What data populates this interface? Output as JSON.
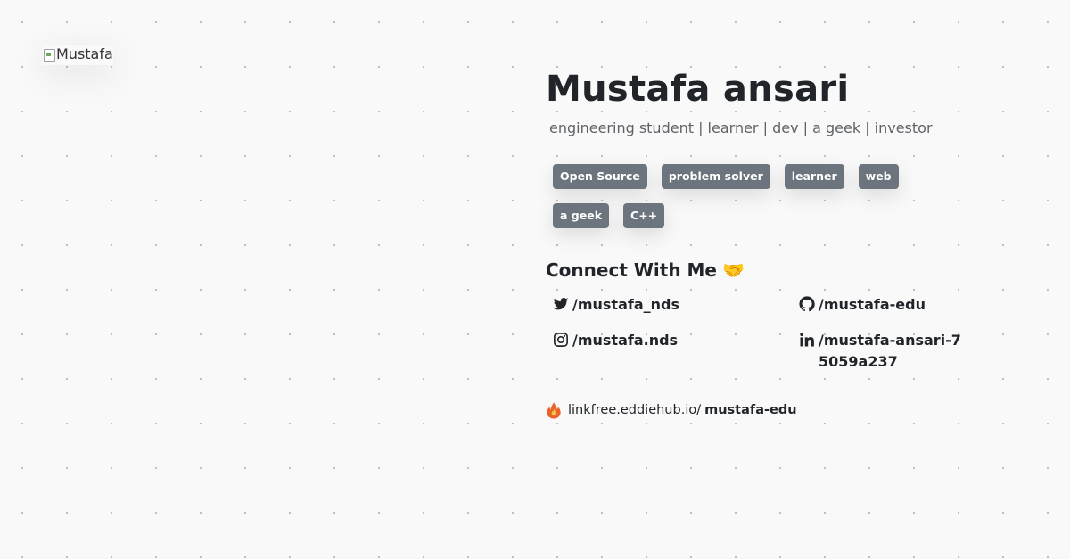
{
  "avatar": {
    "alt": "Mustafa"
  },
  "profile": {
    "name": "Mustafa ansari",
    "bio": "engineering student | learner | dev | a geek | investor"
  },
  "tags": [
    "Open Source",
    "problem solver",
    "learner",
    "web",
    "a geek",
    "C++"
  ],
  "connect": {
    "title": "Connect With Me",
    "icon": "handshake-icon"
  },
  "socials": [
    {
      "platform": "twitter",
      "icon": "twitter-icon",
      "handle": "/mustafa_nds"
    },
    {
      "platform": "github",
      "icon": "github-icon",
      "handle": "/mustafa-edu"
    },
    {
      "platform": "instagram",
      "icon": "instagram-icon",
      "handle": "/mustafa.nds"
    },
    {
      "platform": "linkedin",
      "icon": "linkedin-icon",
      "handle": "/mustafa-ansari-75059a237"
    }
  ],
  "linkfree": {
    "icon": "flame-icon",
    "prefix": "linkfree.eddiehub.io/",
    "handle": "mustafa-edu"
  },
  "colors": {
    "background": "#f9f9f9",
    "tag_background": "#6c757d",
    "text": "#212529",
    "muted": "#5f6368"
  }
}
